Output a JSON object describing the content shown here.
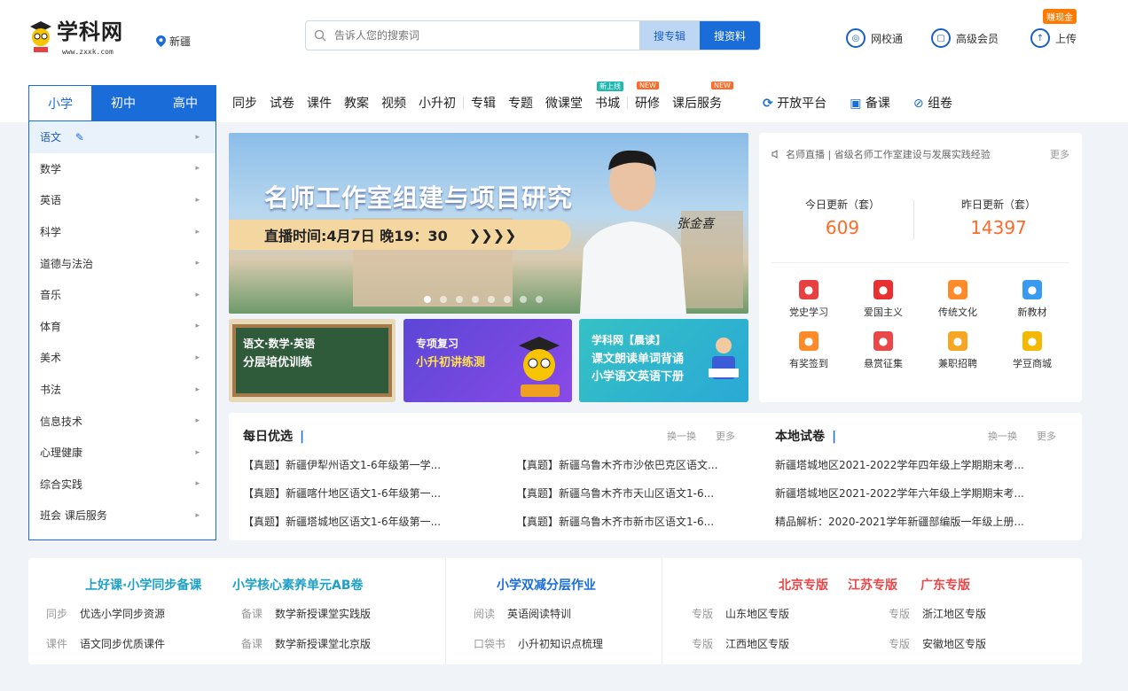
{
  "header": {
    "logo_text": "学科网",
    "logo_url": "www.zxxk.com",
    "location": "新疆",
    "search": {
      "placeholder": "告诉人您的搜索词",
      "btn_secondary": "搜专辑",
      "btn_primary": "搜资料"
    },
    "links": [
      {
        "label": "网校通",
        "icon": "school-icon"
      },
      {
        "label": "高级会员",
        "icon": "vip-icon"
      },
      {
        "label": "上传",
        "icon": "upload-icon"
      }
    ],
    "coin_badge": "赚现金"
  },
  "level_tabs": [
    "小学",
    "初中",
    "高中"
  ],
  "nav": {
    "items": [
      "同步",
      "试卷",
      "课件",
      "教案",
      "视频",
      "小升初",
      "专辑",
      "专题",
      "微课堂",
      "书城",
      "研修",
      "课后服务"
    ],
    "badges": {
      "书城": "新上线",
      "研修": "NEW",
      "课后服务": "NEW"
    },
    "right": [
      "开放平台",
      "备课",
      "组卷"
    ]
  },
  "sidebar": {
    "items": [
      "语文",
      "数学",
      "英语",
      "科学",
      "道德与法治",
      "音乐",
      "体育",
      "美术",
      "书法",
      "信息技术",
      "心理健康",
      "综合实践",
      "班会  课后服务"
    ]
  },
  "banner": {
    "title": "名师工作室组建与项目研究",
    "time": "直播时间:4月7日 晚19：30",
    "arrows": "❯❯❯❯",
    "signature": "张金喜",
    "dots": 8,
    "active_dot": 0
  },
  "promos": [
    {
      "line1": "语文·数学·英语",
      "line2": "分层培优训练"
    },
    {
      "line1": "专项复习",
      "line2": "小升初讲练测"
    },
    {
      "line1": "学科网【晨读】",
      "line2": "课文朗读单词背诵",
      "line3": "小学语文英语下册"
    }
  ],
  "right_panel": {
    "live": "名师直播 | 省级名师工作室建设与发展实践经验",
    "live_more": "更多",
    "stats": [
      {
        "label": "今日更新（套）",
        "value": "609"
      },
      {
        "label": "昨日更新（套）",
        "value": "14397"
      }
    ],
    "grid": [
      {
        "label": "党史学习",
        "icon": "party-history-icon",
        "color": "#e84040"
      },
      {
        "label": "爱国主义",
        "icon": "flag-icon",
        "color": "#e83030"
      },
      {
        "label": "传统文化",
        "icon": "fan-icon",
        "color": "#ff8a2a"
      },
      {
        "label": "新教材",
        "icon": "book-icon",
        "color": "#3a9af0"
      },
      {
        "label": "有奖签到",
        "icon": "checkin-icon",
        "color": "#ff8a2a"
      },
      {
        "label": "悬赏征集",
        "icon": "bag-icon",
        "color": "#e84848"
      },
      {
        "label": "兼职招聘",
        "icon": "person-icon",
        "color": "#f5a623"
      },
      {
        "label": "学豆商城",
        "icon": "coin-icon",
        "color": "#f5b800"
      }
    ]
  },
  "lists": {
    "daily": {
      "title": "每日优选",
      "swap": "换一换",
      "more": "更多"
    },
    "local": {
      "title": "本地试卷",
      "swap": "换一换",
      "more": "更多"
    },
    "col1": [
      "【真题】新疆伊犁州语文1-6年级第一学...",
      "【真题】新疆喀什地区语文1-6年级第一...",
      "【真题】新疆塔城地区语文1-6年级第一..."
    ],
    "col2": [
      "【真题】新疆乌鲁木齐市沙依巴克区语文...",
      "【真题】新疆乌鲁木齐市天山区语文1-6...",
      "【真题】新疆乌鲁木齐市新市区语文1-6..."
    ],
    "col3": [
      "新疆塔城地区2021-2022学年四年级上学期期末考...",
      "新疆塔城地区2021-2022学年六年级上学期期末考...",
      "精品解析：2020-2021学年新疆部编版一年级上册..."
    ]
  },
  "bottom": {
    "heads": [
      "上好课·小学同步备课",
      "小学核心素养单元AB卷",
      "小学双减分层作业",
      "北京专版",
      "江苏专版",
      "广东专版"
    ],
    "items": [
      {
        "tag": "同步",
        "text": "优选小学同步资源"
      },
      {
        "tag": "备课",
        "text": "数学新授课堂实践版"
      },
      {
        "tag": "课件",
        "text": "语文同步优质课件"
      },
      {
        "tag": "备课",
        "text": "数学新授课堂北京版"
      },
      {
        "tag": "阅读",
        "text": "英语阅读特训"
      },
      {
        "tag": "口袋书",
        "text": "小升初知识点梳理"
      },
      {
        "tag": "专版",
        "text": "山东地区专版"
      },
      {
        "tag": "专版",
        "text": "浙江地区专版"
      },
      {
        "tag": "专版",
        "text": "江西地区专版"
      },
      {
        "tag": "专版",
        "text": "安徽地区专版"
      }
    ]
  }
}
